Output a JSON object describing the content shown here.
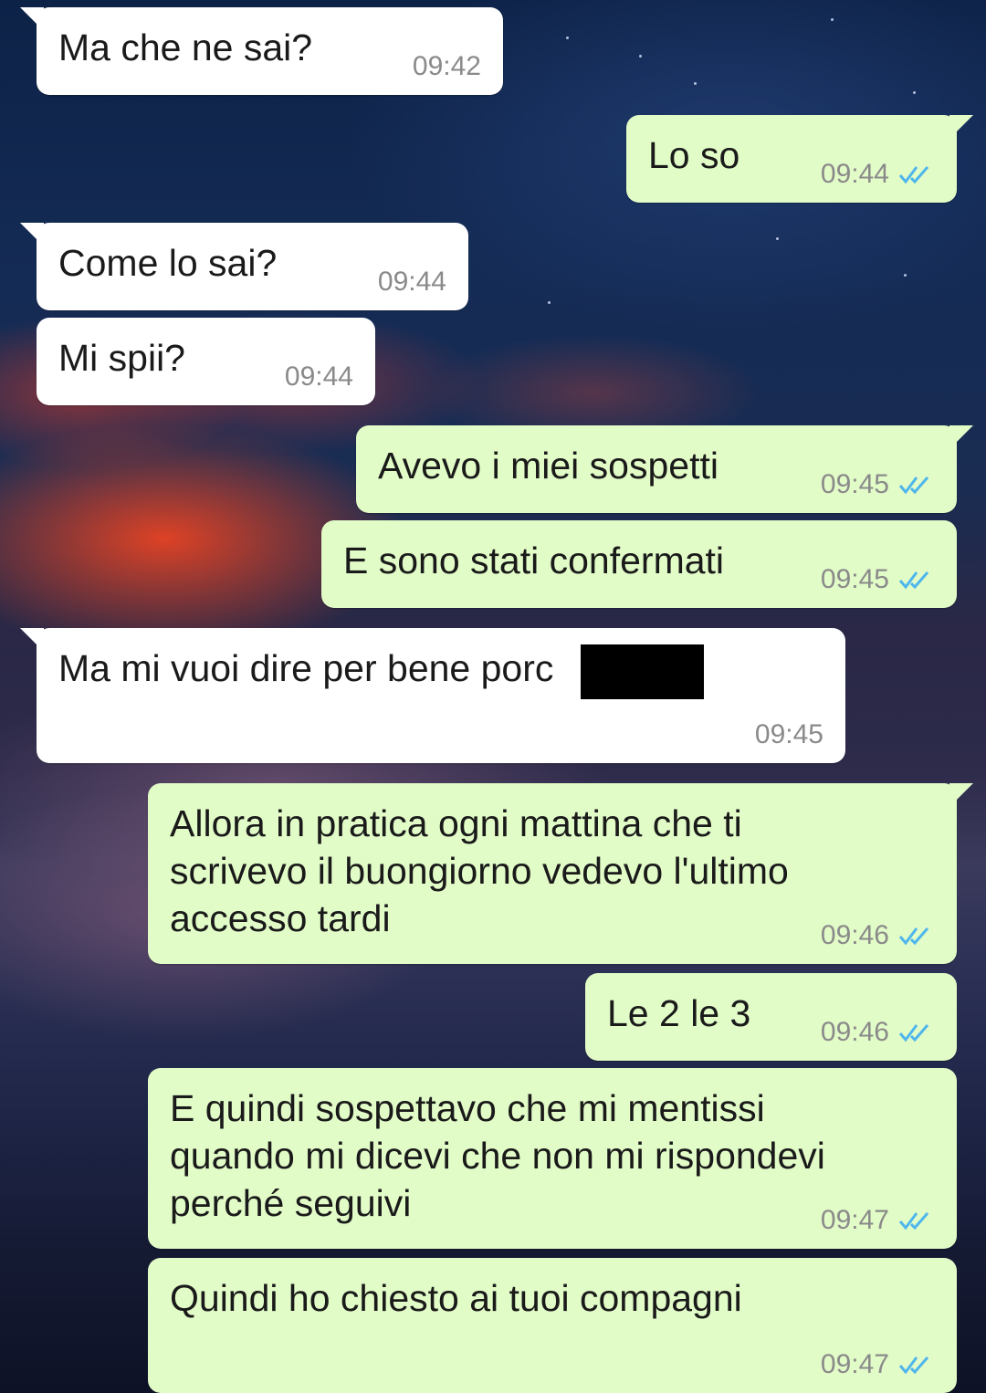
{
  "colors": {
    "incoming_bubble": "#ffffff",
    "outgoing_bubble": "#e2fcc8",
    "read_check": "#4fb6ec",
    "timestamp": "#8a8a8a"
  },
  "messages": [
    {
      "direction": "in",
      "text": "Ma che ne sai?",
      "time": "09:42"
    },
    {
      "direction": "out",
      "text": "Lo so",
      "time": "09:44",
      "status_icon": "double-check-read"
    },
    {
      "direction": "in",
      "text": "Come lo sai?",
      "time": "09:44"
    },
    {
      "direction": "in",
      "text": "Mi spii?",
      "time": "09:44"
    },
    {
      "direction": "out",
      "text": "Avevo i miei sospetti",
      "time": "09:45",
      "status_icon": "double-check-read"
    },
    {
      "direction": "out",
      "text": "E sono stati confermati",
      "time": "09:45",
      "status_icon": "double-check-read"
    },
    {
      "direction": "in",
      "text": "Ma mi vuoi dire per bene porc",
      "time": "09:45",
      "redacted": true
    },
    {
      "direction": "out",
      "text": "Allora in pratica ogni mattina che ti\nscrivevo il buongiorno vedevo l'ultimo\naccesso tardi",
      "time": "09:46",
      "status_icon": "double-check-read"
    },
    {
      "direction": "out",
      "text": "Le 2 le 3",
      "time": "09:46",
      "status_icon": "double-check-read"
    },
    {
      "direction": "out",
      "text": "E quindi sospettavo che mi mentissi\nquando mi dicevi che non mi rispondevi\nperché seguivi",
      "time": "09:47",
      "status_icon": "double-check-read"
    },
    {
      "direction": "out",
      "text": "Quindi ho chiesto ai tuoi compagni",
      "time": "09:47",
      "status_icon": "double-check-read"
    }
  ]
}
